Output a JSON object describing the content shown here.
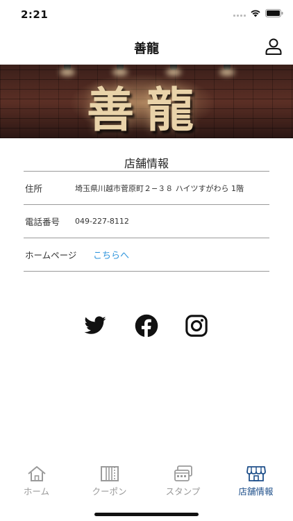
{
  "status_bar": {
    "time": "2:21"
  },
  "header": {
    "title": "善龍"
  },
  "hero": {
    "logo_text": "善龍"
  },
  "store_info": {
    "section_title": "店舗情報",
    "rows": [
      {
        "label": "住所",
        "value": "埼玉県川越市菅原町２−３８ ハイツすがわら 1階"
      },
      {
        "label": "電話番号",
        "value": "049-227-8112"
      },
      {
        "label": "ホームページ",
        "link_text": "こちらへ"
      }
    ]
  },
  "social": {
    "icons": [
      "twitter-icon",
      "facebook-icon",
      "instagram-icon"
    ]
  },
  "tab_bar": {
    "tabs": [
      {
        "label": "ホーム",
        "icon": "home-icon",
        "active": false
      },
      {
        "label": "クーポン",
        "icon": "coupon-icon",
        "active": false
      },
      {
        "label": "スタンプ",
        "icon": "stamp-card-icon",
        "active": false
      },
      {
        "label": "店舗情報",
        "icon": "store-icon",
        "active": true
      }
    ]
  },
  "colors": {
    "link": "#2f95dc",
    "tab_active": "#1e4f8a",
    "tab_inactive": "#9a9a9a"
  }
}
